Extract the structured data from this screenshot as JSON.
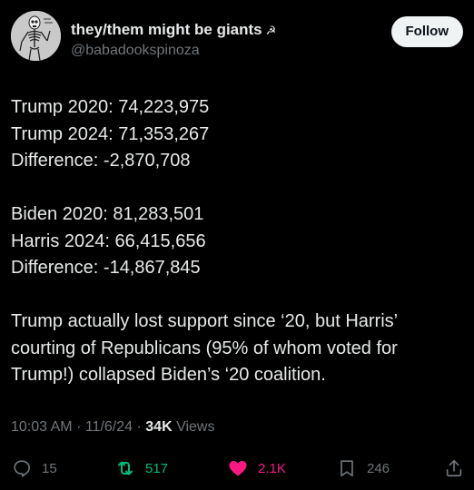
{
  "author": {
    "display_name": "they/them might be giants",
    "name_emoji": "☭",
    "handle": "@babadookspinoza"
  },
  "follow_label": "Follow",
  "post": {
    "paragraphs": [
      [
        "Trump 2020: 74,223,975",
        "Trump 2024: 71,353,267",
        "Difference: -2,870,708"
      ],
      [
        "Biden 2020: 81,283,501",
        "Harris 2024: 66,415,656",
        "Difference: -14,867,845"
      ]
    ],
    "closing_lines": [
      "Trump actually lost support since ‘20, but Harris’",
      "courting of Republicans (95% of whom voted for",
      "Trump!) collapsed Biden’s ‘20 coalition."
    ]
  },
  "meta": {
    "time": "10:03 AM",
    "date": "11/6/24",
    "separator": "·",
    "views_count": "34K",
    "views_label": "Views"
  },
  "actions": {
    "replies": "15",
    "reposts": "517",
    "likes": "2.1K",
    "bookmarks": "246"
  },
  "colors": {
    "background": "#000000",
    "text": "#e7e9ea",
    "muted": "#71767b",
    "repost_active": "#00ba7c",
    "like_active": "#f91880",
    "follow_bg": "#eff3f4"
  },
  "icons": {
    "reply": "speech-bubble-icon",
    "repost": "repost-arrows-icon",
    "like": "heart-icon",
    "bookmark": "bookmark-icon",
    "share": "share-upload-icon"
  }
}
